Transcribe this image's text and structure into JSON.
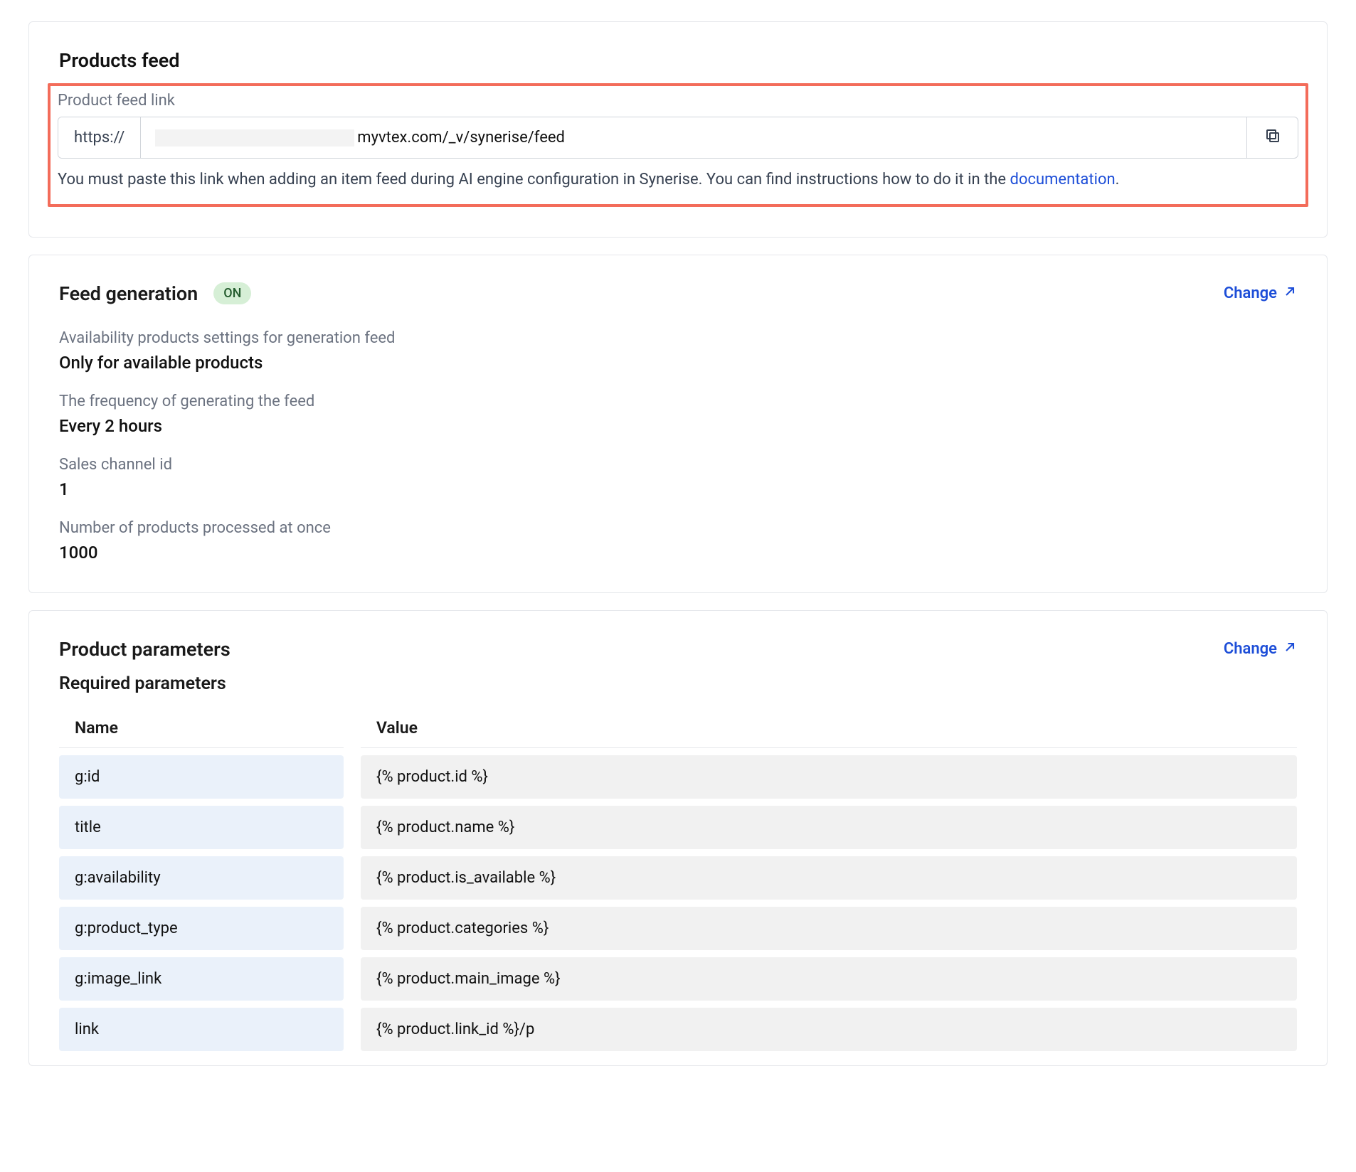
{
  "productsFeed": {
    "title": "Products feed",
    "linkLabel": "Product feed link",
    "prefix": "https://",
    "urlSuffix": "myvtex.com/_v/synerise/feed",
    "hintPrefix": "You must paste this link when adding an item feed during AI engine configuration in Synerise. You can find instructions how to do it in the ",
    "hintLinkText": "documentation",
    "hintSuffix": "."
  },
  "feedGen": {
    "title": "Feed generation",
    "badge": "ON",
    "changeLabel": "Change",
    "availLabel": "Availability products settings for generation feed",
    "availValue": "Only for available products",
    "freqLabel": "The frequency of generating the feed",
    "freqValue": "Every 2 hours",
    "channelLabel": "Sales channel id",
    "channelValue": "1",
    "batchLabel": "Number of products processed at once",
    "batchValue": "1000"
  },
  "params": {
    "title": "Product parameters",
    "changeLabel": "Change",
    "requiredTitle": "Required parameters",
    "nameHeader": "Name",
    "valueHeader": "Value",
    "rows": [
      {
        "name": "g:id",
        "value": "{% product.id %}"
      },
      {
        "name": "title",
        "value": "{% product.name %}"
      },
      {
        "name": "g:availability",
        "value": "{% product.is_available %}"
      },
      {
        "name": "g:product_type",
        "value": "{% product.categories %}"
      },
      {
        "name": "g:image_link",
        "value": "{% product.main_image %}"
      },
      {
        "name": "link",
        "value": "{% product.link_id %}/p"
      }
    ]
  }
}
